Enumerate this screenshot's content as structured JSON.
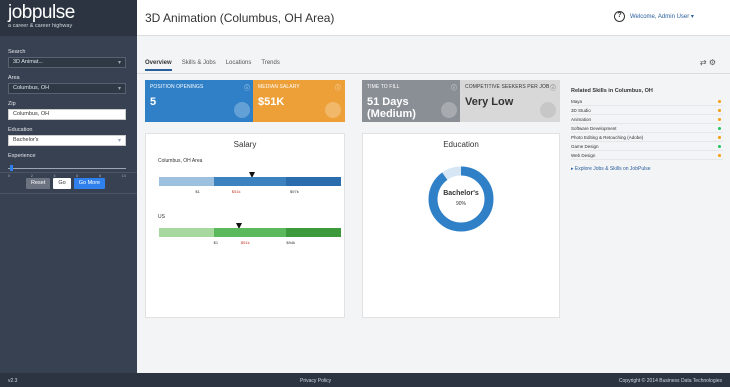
{
  "brand": {
    "logo_job": "job",
    "logo_pulse": "pulse",
    "tagline": "a career & career highway"
  },
  "page": {
    "title": "3D Animation (Columbus, OH Area)"
  },
  "user": {
    "menu": "Welcome, Admin User ▾"
  },
  "sidebar": {
    "fields": [
      {
        "label": "Search",
        "value": "3D Animat..."
      },
      {
        "label": "Area",
        "value": "Columbus, OH"
      },
      {
        "label": "Zip",
        "value": "Columbus, OH"
      },
      {
        "label": "Education",
        "value": "Bachelor's"
      },
      {
        "label": "Experience",
        "value": ""
      }
    ],
    "slider_ticks": [
      "0",
      "2",
      "4",
      "6",
      "8",
      "10"
    ],
    "buttons": {
      "reset": "Reset",
      "save": "Go",
      "more": "Go More"
    }
  },
  "tabs": [
    {
      "label": "Overview",
      "active": true
    },
    {
      "label": "Skills & Jobs",
      "active": false
    },
    {
      "label": "Locations",
      "active": false
    },
    {
      "label": "Trends",
      "active": false
    }
  ],
  "tools": "⇄  ⚙",
  "stats": {
    "openings": {
      "label": "POSITION OPENINGS",
      "value": "5",
      "color": "#2f80c7"
    },
    "salary": {
      "label": "MEDIAN SALARY",
      "value": "$51K",
      "color": "#eda038"
    },
    "time": {
      "label": "TIME TO FILL",
      "value": "51 Days (Medium)",
      "color": "#8a8f96"
    },
    "competition": {
      "label": "COMPETITIVE SEEKERS PER JOB",
      "value": "Very Low",
      "color": "#d8d8d8"
    }
  },
  "salary": {
    "title": "Salary",
    "bars": [
      {
        "label": "Columbus, OH Area",
        "marker_pct": 0.51,
        "ticks": [
          "$1",
          "$51k",
          "$97k",
          "$"
        ]
      },
      {
        "label": "US",
        "marker_pct": 0.44,
        "ticks": [
          "$1",
          "$51k",
          "$94k",
          "$"
        ]
      }
    ]
  },
  "education": {
    "title": "Education",
    "center_label": "Bachelor's",
    "center_sub": "90%",
    "share": 0.9
  },
  "related": {
    "heading": "Related Skills in Columbus, OH",
    "items": [
      {
        "label": "Maya",
        "dot": "#f59e0b"
      },
      {
        "label": "3D Studio",
        "dot": "#f59e0b"
      },
      {
        "label": "Animation",
        "dot": "#f59e0b"
      },
      {
        "label": "Software Development",
        "dot": "#22c55e"
      },
      {
        "label": "Photo Editing & Retouching (Adobe)",
        "dot": "#f59e0b"
      },
      {
        "label": "Game Design",
        "dot": "#22c55e"
      },
      {
        "label": "Web Design",
        "dot": "#f59e0b"
      }
    ],
    "link": "▸ Explore Jobs & Skills on JobPulse"
  },
  "footer": {
    "left": "v2.3",
    "center": "Privacy Policy",
    "right": "Copyright © 2014 Business Data Technologies"
  }
}
